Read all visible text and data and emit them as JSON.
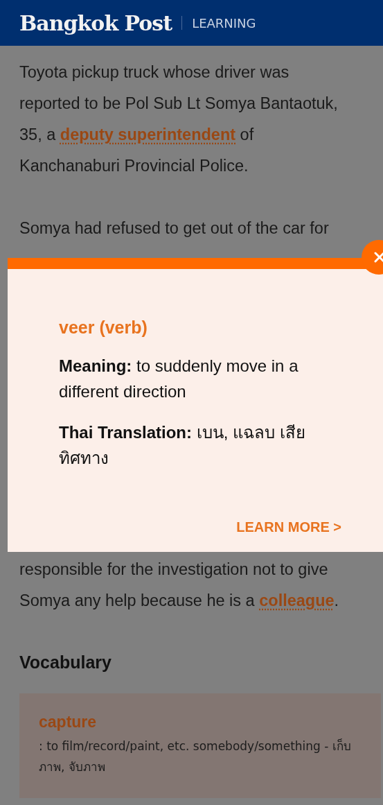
{
  "header": {
    "logo": "Bangkok Post",
    "section": "LEARNING"
  },
  "article": {
    "top_lines": [
      [
        {
          "text": "Toyota pickup truck whose driver was"
        }
      ],
      [
        {
          "text": "reported to be Pol Sub Lt Somya Bantaotuk,"
        }
      ],
      [
        {
          "text": "35, a "
        },
        {
          "text": "deputy superintendent",
          "kind": "link"
        },
        {
          "text": " of"
        }
      ],
      [
        {
          "text": "Kanchanaburi Provincial Police."
        }
      ]
    ],
    "second_lines": [
      [
        {
          "text": "Somya had refused to get out of the car for"
        }
      ]
    ],
    "bottom_lines": [
      [
        {
          "text": "responsible for the investigation not to give"
        }
      ],
      [
        {
          "text": "Somya any help because he is a "
        },
        {
          "text": "colleague",
          "kind": "link"
        },
        {
          "text": "."
        }
      ]
    ]
  },
  "vocabulary": {
    "heading": "Vocabulary",
    "items": [
      {
        "word": "capture",
        "definition": ": to film/record/paint, etc. somebody/something - เก็บภาพ, จับภาพ"
      }
    ]
  },
  "popup": {
    "term": "veer (verb)",
    "meaning_label": "Meaning:",
    "meaning": "to suddenly move in a different direction",
    "translation_label": "Thai Translation:",
    "translation": "เบน, แฉลบ เสียทิศทาง",
    "learn_more": "LEARN MORE >"
  }
}
